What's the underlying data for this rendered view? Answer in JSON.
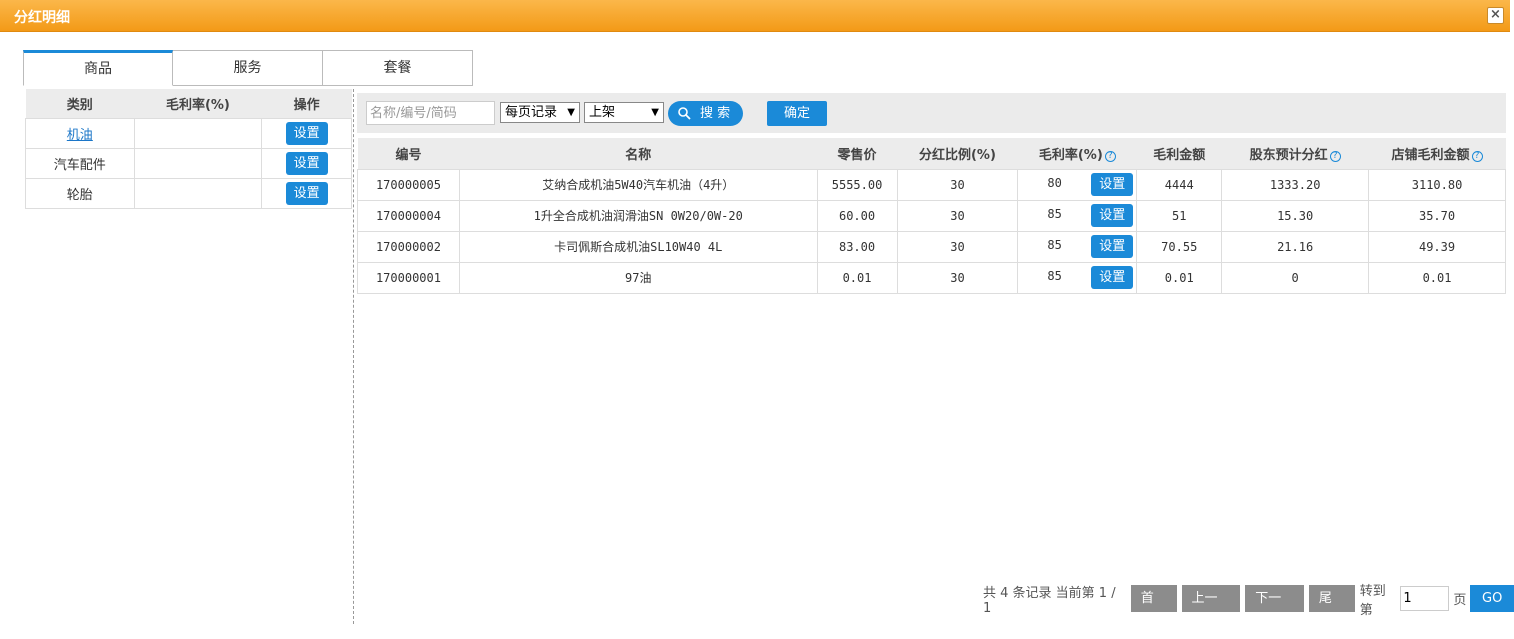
{
  "window": {
    "title": "分红明细",
    "close": "×"
  },
  "tabs": [
    "商品",
    "服务",
    "套餐"
  ],
  "category_table": {
    "headers": [
      "类别",
      "毛利率(%)",
      "操作"
    ],
    "rows": [
      {
        "name": "机油",
        "rate": "",
        "action": "设置",
        "link": true
      },
      {
        "name": "汽车配件",
        "rate": "",
        "action": "设置",
        "link": false
      },
      {
        "name": "轮胎",
        "rate": "",
        "action": "设置",
        "link": false
      }
    ]
  },
  "toolbar": {
    "search_placeholder": "名称/编号/简码",
    "page_size_select": "每页记录",
    "status_select": "上架",
    "search_button": "搜 索",
    "confirm_button": "确定"
  },
  "product_table": {
    "headers": [
      "编号",
      "名称",
      "零售价",
      "分红比例(%)",
      "毛利率(%)",
      "毛利金额",
      "股东预计分红",
      "店铺毛利金额"
    ],
    "help_icon": "?",
    "set_label": "设置",
    "rows": [
      {
        "code": "170000005",
        "name": "艾纳合成机油5W40汽车机油（4升）",
        "price": "5555.00",
        "ratio": "30",
        "rate": "80",
        "profit": "4444",
        "dividend": "1333.20",
        "store_profit": "3110.80"
      },
      {
        "code": "170000004",
        "name": "1升全合成机油润滑油SN 0W20/0W-20",
        "price": "60.00",
        "ratio": "30",
        "rate": "85",
        "profit": "51",
        "dividend": "15.30",
        "store_profit": "35.70"
      },
      {
        "code": "170000002",
        "name": "卡司佩斯合成机油SL10W40 4L",
        "price": "83.00",
        "ratio": "30",
        "rate": "85",
        "profit": "70.55",
        "dividend": "21.16",
        "store_profit": "49.39"
      },
      {
        "code": "170000001",
        "name": "97油",
        "price": "0.01",
        "ratio": "30",
        "rate": "85",
        "profit": "0.01",
        "dividend": "0",
        "store_profit": "0.01"
      }
    ]
  },
  "pagination": {
    "info": "共 4 条记录 当前第 1 / 1",
    "first": "首页",
    "prev": "上一页",
    "next": "下一页",
    "last": "尾页",
    "goto_label": "转到第",
    "page_value": "1",
    "page_unit": "页",
    "go": "GO"
  }
}
